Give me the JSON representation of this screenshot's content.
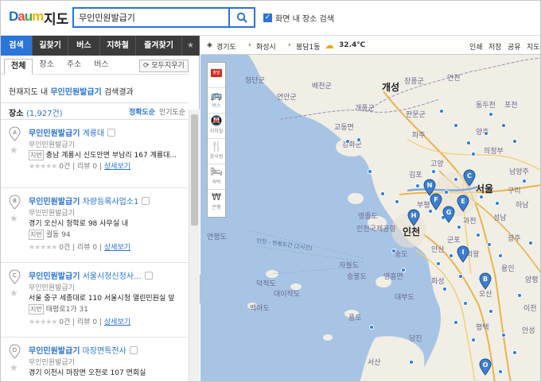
{
  "header": {
    "logo": "Daum",
    "service": "지도",
    "search_value": "무인민원발급기",
    "search_icon": "search-icon",
    "map_search_checkbox_label": "화면 내 장소 검색",
    "map_search_checked": true
  },
  "nav_tabs": [
    {
      "label": "검색",
      "active": true
    },
    {
      "label": "길찾기"
    },
    {
      "label": "버스"
    },
    {
      "label": "지하철"
    },
    {
      "label": "즐겨찾기"
    }
  ],
  "subtabs": [
    {
      "label": "전체",
      "active": true
    },
    {
      "label": "장소"
    },
    {
      "label": "주소"
    },
    {
      "label": "버스"
    }
  ],
  "clear_button": "모두지우기",
  "result_desc": {
    "prefix": "현재지도 내 ",
    "keyword": "무인민원발급기",
    "suffix": " 검색결과"
  },
  "count": {
    "label": "장소",
    "value": "(1,927건)",
    "sort_accuracy": "정확도순",
    "sort_popular": "인기도순"
  },
  "results": [
    {
      "marker": "A",
      "keyword": "무인민원발급기",
      "name": " 계룡대",
      "category": "무인민원발급기",
      "address_tag": "지번",
      "address": "충남 계룡시 신도안면 부남리 167 계룡대...",
      "jibun": "",
      "rating": "0건 | 리뷰 0 |",
      "detail": "상세보기"
    },
    {
      "marker": "B",
      "keyword": "무인민원발급기",
      "name": " 차량등록사업소1",
      "category": "무인민원발급기",
      "address_tag": "",
      "address": "경기 오산시 청학로 98 사무실 내",
      "jibun_tag": "지번",
      "jibun": "궐동 94",
      "rating": "0건 | 리뷰 0 |",
      "detail": "상세보기"
    },
    {
      "marker": "C",
      "keyword": "무인민원발급기",
      "name": " 서울시청신청사...",
      "category": "무인민원발급기",
      "address_tag": "",
      "address": "서울 중구 세종대로 110 서울시청 열린민원실 앞",
      "jibun_tag": "지번",
      "jibun": "태평로1가 31",
      "rating": "0건 | 리뷰 0 |",
      "detail": "상세보기"
    },
    {
      "marker": "D",
      "keyword": "무인민원발급기",
      "name": " 마장면특전사",
      "category": "무인민원발급기",
      "address_tag": "",
      "address": "경기 이천시 마장면 오천로 107 면회실",
      "jibun": "",
      "rating": "",
      "detail": ""
    }
  ],
  "map_top": {
    "region1": "경기도",
    "region2": "화성시",
    "region3": "봉담1동",
    "weather_icon": "partly-cloudy-icon",
    "temperature": "32.4℃",
    "print": "인쇄",
    "save": "저장",
    "share": "공유",
    "map_type": "지도"
  },
  "map_tools": [
    {
      "label": "출발",
      "icon": "start-flag-icon"
    },
    {
      "label": "버스",
      "icon": "bus-icon"
    },
    {
      "label": "지하철",
      "icon": "subway-icon"
    },
    {
      "label": "음식점",
      "icon": "restaurant-icon"
    },
    {
      "label": "숙박",
      "icon": "lodging-icon"
    },
    {
      "label": "은행",
      "icon": "bank-icon"
    }
  ],
  "map_labels": {
    "cities": [
      "개성",
      "서울",
      "인천"
    ],
    "places": [
      "청단군",
      "배천군",
      "연안군",
      "개풍군",
      "판문군",
      "장풍군",
      "동두천",
      "연천",
      "포천",
      "파주",
      "양주",
      "의정부",
      "고양",
      "남양주",
      "구리",
      "김포",
      "부평",
      "과천",
      "성남",
      "광주",
      "하남",
      "안산",
      "군포",
      "의왕",
      "용인",
      "화성",
      "오산",
      "평택",
      "안성",
      "당진",
      "강화군",
      "교동면",
      "송도",
      "인천국제공항",
      "영흥면",
      "대부도",
      "덕적도",
      "영종도",
      "백아도",
      "자월도",
      "승봉도",
      "풍도",
      "대이작도",
      "서산",
      "양평",
      "이천",
      "연평도"
    ],
    "sea": "인천 - 연평도간 (2시간)",
    "markers": [
      "A",
      "B",
      "C",
      "D",
      "E",
      "F",
      "G",
      "H",
      "I",
      "N",
      "O"
    ]
  },
  "colors": {
    "accent": "#2b74d9",
    "tab_bar": "#3b3b3b",
    "sea": "#a8c4e4",
    "land": "#f1eee5",
    "marker": "#3d7fcf"
  }
}
